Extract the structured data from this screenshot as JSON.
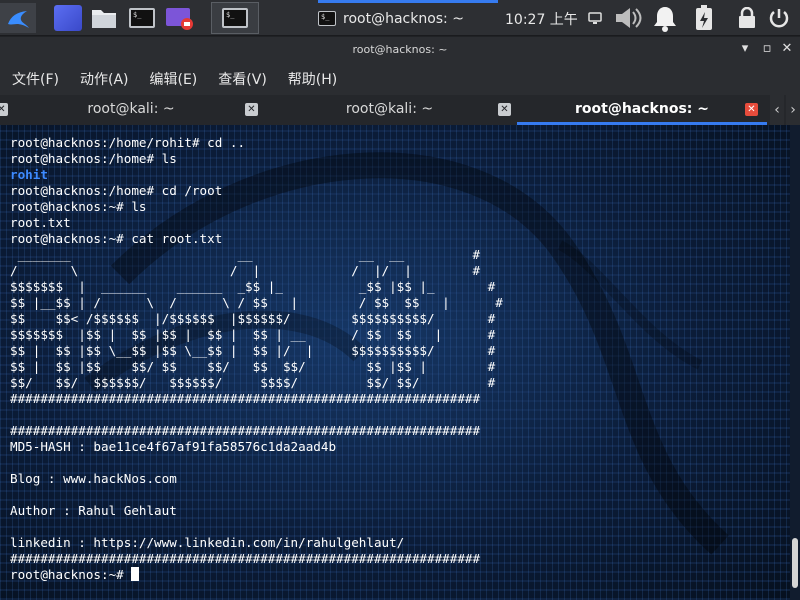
{
  "panel": {
    "active_window_title": "root@hacknos: ~",
    "clock": "10:27 上午",
    "icons": [
      "kali-menu-icon",
      "workspace-icon",
      "file-manager-icon",
      "terminal-icon",
      "screen-recorder-icon",
      "volume-icon",
      "notification-bell-icon",
      "power-manager-icon",
      "lock-icon",
      "power-icon"
    ],
    "accent": "#367bf0"
  },
  "window": {
    "title": "root@hacknos: ~",
    "menu": [
      "文件(F)",
      "动作(A)",
      "编辑(E)",
      "查看(V)",
      "帮助(H)"
    ],
    "tabs": [
      {
        "label": "root@kali: ~",
        "active": false
      },
      {
        "label": "root@kali: ~",
        "active": false
      },
      {
        "label": "root@hacknos: ~",
        "active": true
      }
    ]
  },
  "terminal": {
    "lines": [
      "root@hacknos:/home/rohit# cd ..",
      "root@hacknos:/home# ls",
      "rohit",
      "root@hacknos:/home# cd /root",
      "root@hacknos:~# ls",
      "root.txt",
      "root@hacknos:~# cat root.txt",
      " _______                      __              __  __         #",
      "/       \\                    /  |            /  |/  |        #",
      "$$$$$$$  |  ______    ______  _$$ |_          _$$ |$$ |_       #",
      "$$ |__$$ | /      \\  /      \\ / $$   |        / $$  $$   |      #",
      "$$    $$< /$$$$$$  |/$$$$$$  |$$$$$$/        $$$$$$$$$$/       #",
      "$$$$$$$  |$$ |  $$ |$$ |  $$ |  $$ | __      / $$  $$   |      #",
      "$$ |  $$ |$$ \\__$$ |$$ \\__$$ |  $$ |/  |     $$$$$$$$$$/       #",
      "$$ |  $$ |$$    $$/ $$    $$/   $$  $$/        $$ |$$ |        #",
      "$$/   $$/  $$$$$$/   $$$$$$/     $$$$/         $$/ $$/         #",
      "##############################################################",
      "",
      "##############################################################",
      "MD5-HASH : bae11ce4f67af91fa58576c1da2aad4b",
      "",
      "Blog : www.hackNos.com",
      "",
      "Author : Rahul Gehlaut",
      "",
      "linkedin : https://www.linkedin.com/in/rahulgehlaut/",
      "##############################################################",
      "root@hacknos:~# "
    ],
    "highlight_color": "#3d8bff"
  }
}
